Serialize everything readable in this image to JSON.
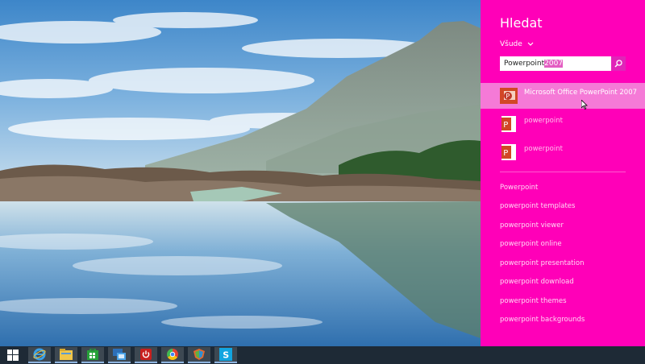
{
  "search": {
    "title": "Hledat",
    "scope": "Všude",
    "query_typed": "Powerpoint",
    "query_autocomplete": "2007"
  },
  "results": [
    {
      "label": "Microsoft Office PowerPoint 2007",
      "icon": "office-powerpoint-2007-icon",
      "highlighted": true
    },
    {
      "label": "powerpoint",
      "icon": "powerpoint-file-icon"
    },
    {
      "label": "powerpoint",
      "icon": "powerpoint-file-icon"
    }
  ],
  "suggestions": [
    "Powerpoint",
    "powerpoint templates",
    "powerpoint viewer",
    "powerpoint online",
    "powerpoint presentation",
    "powerpoint download",
    "powerpoint themes",
    "powerpoint backgrounds"
  ],
  "taskbar": {
    "items": [
      "start-icon",
      "internet-explorer-icon",
      "file-explorer-icon",
      "store-icon",
      "remote-desktop-icon",
      "power-icon",
      "chrome-icon",
      "shield-app-icon",
      "skype-icon"
    ]
  },
  "colors": {
    "charm_bg": "#ff00b8",
    "highlight": "#f57ad7",
    "taskbar": "#1e2a36"
  }
}
